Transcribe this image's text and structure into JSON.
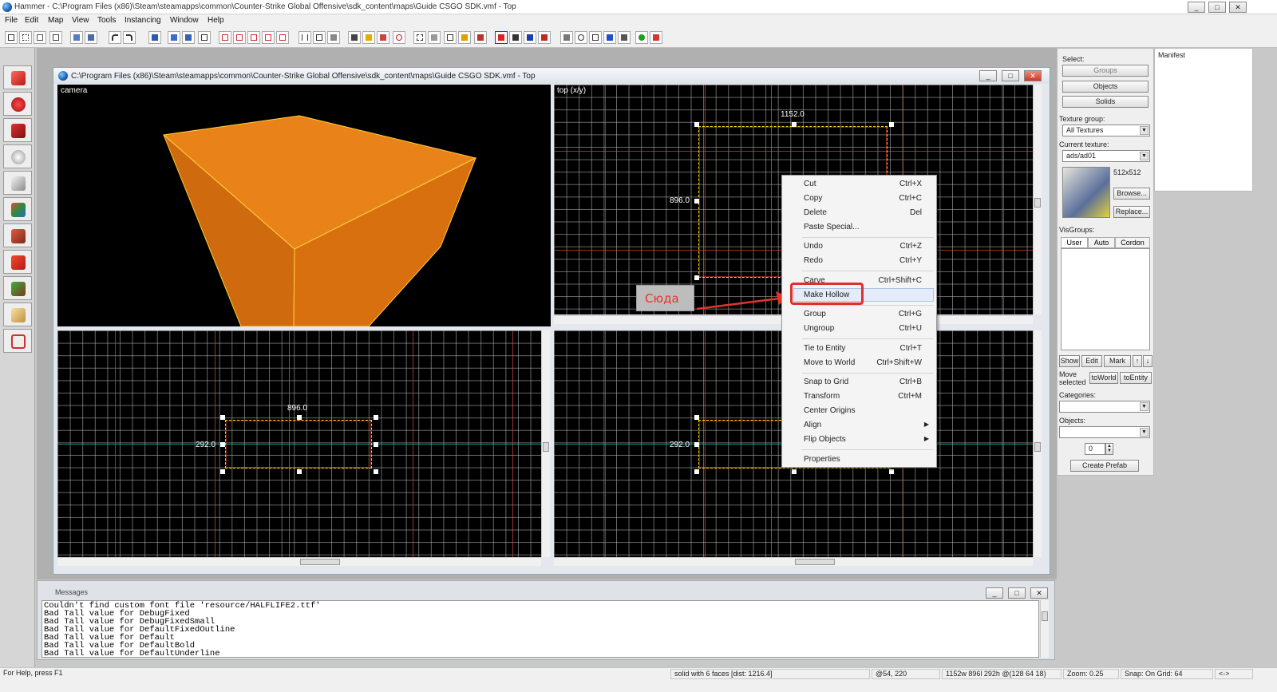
{
  "window": {
    "title": "Hammer - C:\\Program Files (x86)\\Steam\\steamapps\\common\\Counter-Strike Global Offensive\\sdk_content\\maps\\Guide CSGO SDK.vmf - Top",
    "minimize": "_",
    "maximize": "□",
    "close": "✕"
  },
  "menu": [
    "File",
    "Edit",
    "Map",
    "View",
    "Tools",
    "Instancing",
    "Window",
    "Help"
  ],
  "document": {
    "title": "C:\\Program Files (x86)\\Steam\\steamapps\\common\\Counter-Strike Global Offensive\\sdk_content\\maps\\Guide CSGO SDK.vmf - Top"
  },
  "views": {
    "camera": "camera",
    "top": "top (x/y)",
    "top_width": "1152.0",
    "top_height": "896.0",
    "front_width": "896.0",
    "front_height": "292.0",
    "side_height": "292.0"
  },
  "context_menu": {
    "items": [
      {
        "label": "Cut",
        "shortcut": "Ctrl+X"
      },
      {
        "label": "Copy",
        "shortcut": "Ctrl+C"
      },
      {
        "label": "Delete",
        "shortcut": "Del"
      },
      {
        "label": "Paste Special...",
        "shortcut": ""
      },
      {
        "label": "Undo",
        "shortcut": "Ctrl+Z"
      },
      {
        "label": "Redo",
        "shortcut": "Ctrl+Y"
      },
      {
        "label": "Carve",
        "shortcut": "Ctrl+Shift+C"
      },
      {
        "label": "Make Hollow",
        "shortcut": ""
      },
      {
        "label": "Group",
        "shortcut": "Ctrl+G"
      },
      {
        "label": "Ungroup",
        "shortcut": "Ctrl+U"
      },
      {
        "label": "Tie to Entity",
        "shortcut": "Ctrl+T"
      },
      {
        "label": "Move to World",
        "shortcut": "Ctrl+Shift+W"
      },
      {
        "label": "Snap to Grid",
        "shortcut": "Ctrl+B"
      },
      {
        "label": "Transform",
        "shortcut": "Ctrl+M"
      },
      {
        "label": "Center Origins",
        "shortcut": ""
      },
      {
        "label": "Align",
        "shortcut": ""
      },
      {
        "label": "Flip Objects",
        "shortcut": ""
      },
      {
        "label": "Properties",
        "shortcut": ""
      }
    ],
    "submenu_arrow": "▶"
  },
  "annotation": {
    "text": "Сюда",
    "color": "#e3342a"
  },
  "right_panel": {
    "select_label": "Select:",
    "groups": "Groups",
    "objects": "Objects",
    "solids": "Solids",
    "texture_group_label": "Texture group:",
    "texture_group_value": "All Textures",
    "current_texture_label": "Current texture:",
    "current_texture_value": "ads/ad01",
    "texture_size": "512x512",
    "browse": "Browse...",
    "replace": "Replace...",
    "visgroups_label": "VisGroups:",
    "tabs": [
      "User",
      "Auto",
      "Cordon"
    ],
    "show": "Show",
    "edit": "Edit",
    "mark": "Mark",
    "up": "↑",
    "down": "↓",
    "move_selected": "Move selected",
    "to_world": "toWorld",
    "to_entity": "toEntity",
    "categories_label": "Categories:",
    "objects_label": "Objects:",
    "spinner_value": "0",
    "create_prefab": "Create Prefab"
  },
  "manifest": {
    "title": "Manifest"
  },
  "messages": {
    "title": "Messages",
    "lines": [
      "Couldn't find custom font file 'resource/HALFLIFE2.ttf'",
      "Bad Tall value for DebugFixed",
      "Bad Tall value for DebugFixedSmall",
      "Bad Tall value for DefaultFixedOutline",
      "Bad Tall value for Default",
      "Bad Tall value for DefaultBold",
      "Bad Tall value for DefaultUnderline"
    ]
  },
  "status": {
    "help": "For Help, press F1",
    "selection": "solid with 6 faces  [dist: 1216.4]",
    "cursor": "@54, 220",
    "size": "1152w 896l 292h @(128 64 18)",
    "zoom": "Zoom: 0.25",
    "snap": "Snap: On Grid: 64",
    "arrows": "<->"
  },
  "colors": {
    "accent_red": "#e0302a",
    "brush_orange": "#e0730f",
    "selection_yellow": "#ffd400"
  }
}
